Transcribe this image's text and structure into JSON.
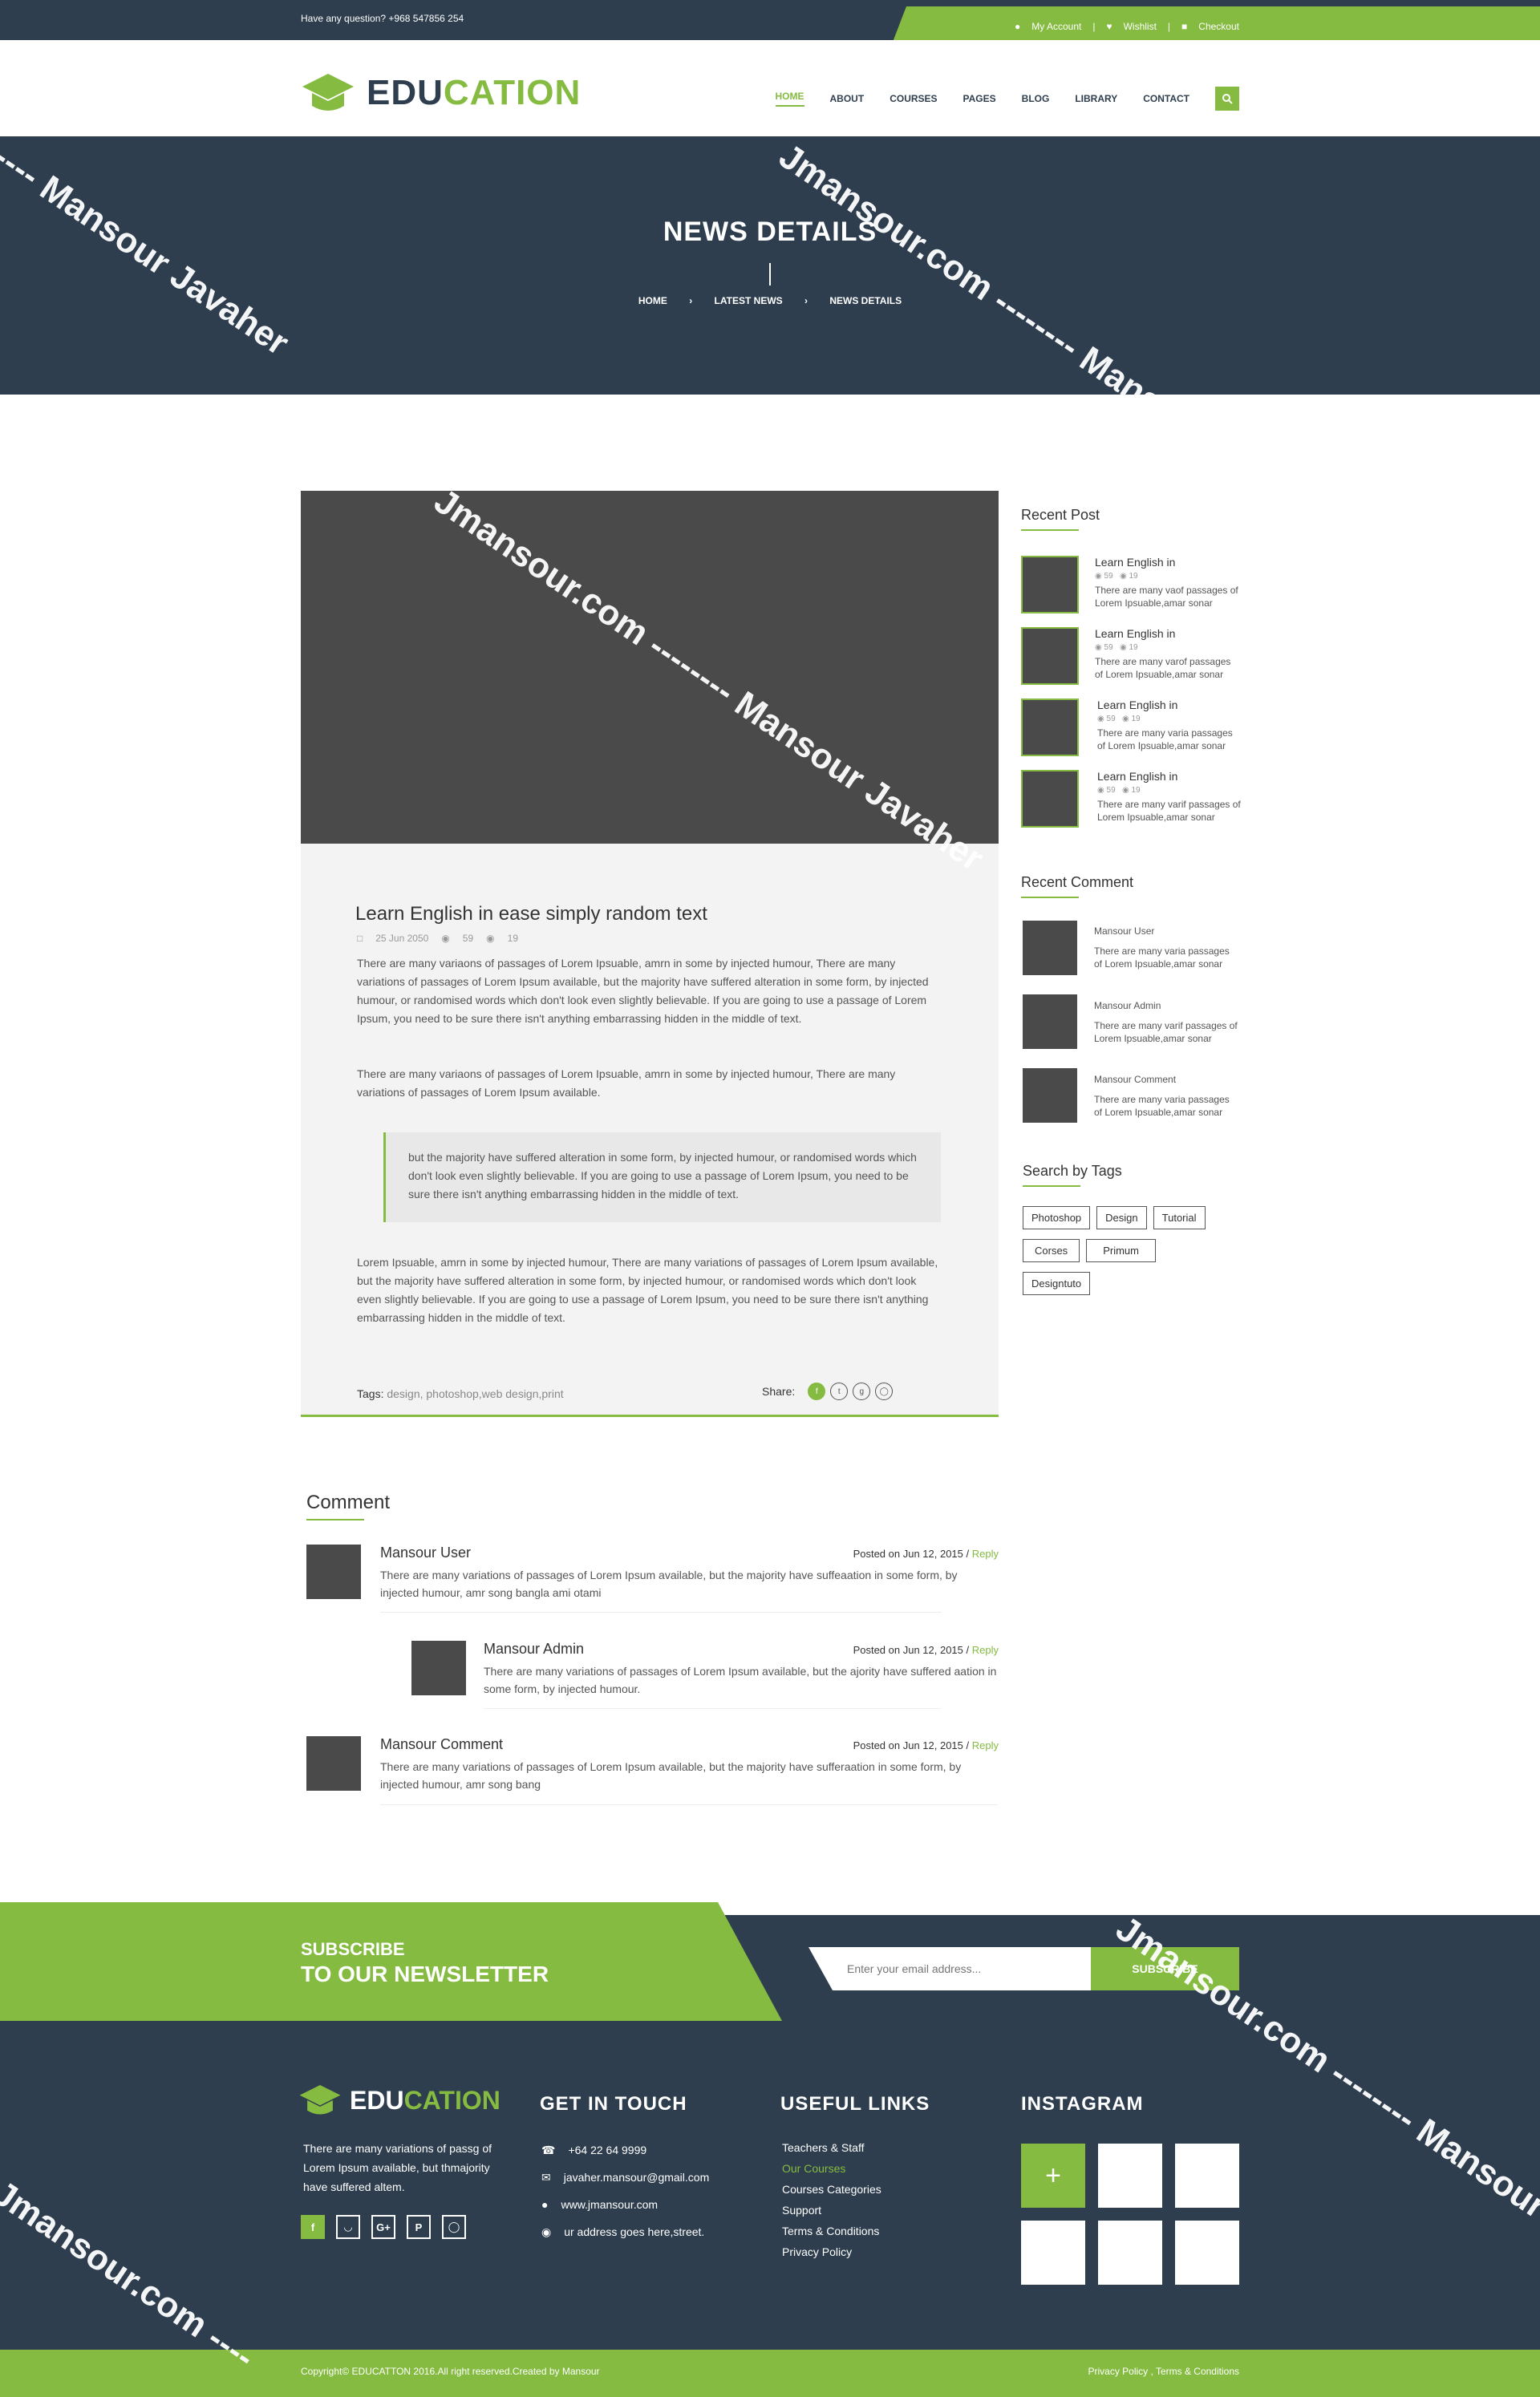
{
  "topbar": {
    "question": "Have any question? +968 547856 254",
    "links": [
      "My Account",
      "Wishlist",
      "Checkout"
    ]
  },
  "header": {
    "logo_part1": "EDU",
    "logo_part2": "CATION",
    "nav": [
      "HOME",
      "ABOUT",
      "COURSES",
      "PAGES",
      "BLOG",
      "LIBRARY",
      "CONTACT"
    ],
    "active_nav": "HOME"
  },
  "banner": {
    "title": "NEWS DETAILS",
    "breadcrumb": [
      "HOME",
      "LATEST NEWS",
      "NEWS DETAILS"
    ]
  },
  "post": {
    "title": "Learn English in ease simply random text",
    "date": "25 Jun 2050",
    "views": "59",
    "comments": "19",
    "para1": "There are many variaons of passages of Lorem Ipsuable, amrn in some by injected humour, There are many variations of passages of Lorem Ipsum available, but the majority have suffered alteration in some form, by injected humour, or randomised words which don't look even slightly believable. If you are going to use a passage of Lorem Ipsum, you need to be sure there isn't anything embarrassing hidden in the middle of text.",
    "para2": "There are many variaons of passages of Lorem Ipsuable, amrn in some by injected humour, There are many variations of passages of Lorem Ipsum available.",
    "quote": "but the majority have suffered alteration in some form, by injected humour, or randomised words which don't look even slightly believable. If you are going to use a passage of Lorem Ipsum, you need to be sure there isn't anything embarrassing hidden in the middle of text.",
    "para3": "Lorem Ipsuable, amrn in some by injected humour, There are many variations of passages of Lorem Ipsum available, but the majority have suffered alteration in some form, by injected humour, or randomised words which don't look even slightly believable. If you are going to use a passage of Lorem Ipsum, you need to be sure there isn't anything embarrassing hidden in the middle of text.",
    "tags_label": "Tags:",
    "tags_value": " design, photoshop,web design,print",
    "share_label": "Share:"
  },
  "sidebar": {
    "recent_post_title": "Recent Post",
    "recent_posts": [
      {
        "title": "Learn English in",
        "views": "59",
        "comments": "19",
        "text": "There are many vaof passages of Lorem Ipsuable,amar sonar"
      },
      {
        "title": "Learn English in",
        "views": "59",
        "comments": "19",
        "text": "There are many varof passages of Lorem Ipsuable,amar sonar"
      },
      {
        "title": "Learn English in",
        "views": "59",
        "comments": "19",
        "text": "There are many varia passages of Lorem Ipsuable,amar sonar"
      },
      {
        "title": "Learn English in",
        "views": "59",
        "comments": "19",
        "text": "There are many varif passages of Lorem Ipsuable,amar sonar"
      }
    ],
    "recent_comment_title": "Recent Comment",
    "recent_comments": [
      {
        "name": "Mansour User",
        "text": "There are many varia passages of Lorem Ipsuable,amar sonar"
      },
      {
        "name": "Mansour Admin",
        "text": "There are many varif passages of Lorem Ipsuable,amar sonar"
      },
      {
        "name": "Mansour Comment",
        "text": "There are many varia passages of Lorem Ipsuable,amar sonar"
      }
    ],
    "tags_title": "Search by Tags",
    "tags": [
      "Photoshop",
      "Design",
      "Tutorial",
      "Corses",
      "Primum",
      "Designtuto"
    ]
  },
  "comments": {
    "title": "Comment",
    "items": [
      {
        "name": "Mansour User",
        "posted": "Posted on Jun 12, 2015 /",
        "reply": "Reply",
        "text": "There are many variations of passages of Lorem Ipsum available, but the majority have suffeaation in some form, by injected humour, amr song bangla ami otami"
      },
      {
        "name": "Mansour Admin",
        "posted": "Posted on Jun 12, 2015 /",
        "reply": "Reply",
        "text": "There are many variations of passages of Lorem Ipsum available, but the ajority have suffered aation in some form, by injected humour."
      },
      {
        "name": "Mansour Comment",
        "posted": "Posted on Jun 12, 2015 /",
        "reply": "Reply",
        "text": "There are many variations of passages of Lorem Ipsum available, but the majority have sufferaation in some form, by injected humour, amr song bang"
      }
    ]
  },
  "newsletter": {
    "line1": "SUBSCRIBE",
    "line2": "TO OUR NEWSLETTER",
    "placeholder": "Enter your email address...",
    "button": "SUBSCRIBE"
  },
  "footer": {
    "about_text": "There are many variations of passg of Lorem Ipsum available, but thmajority have suffered altem.",
    "get_in_touch": "GET IN TOUCH",
    "contacts": [
      "+64 22 64 9999",
      "javaher.mansour@gmail.com",
      "www.jmansour.com",
      "ur address goes here,street."
    ],
    "useful_links_title": "USEFUL LINKS",
    "links": [
      "Teachers & Staff",
      "Our Courses",
      "Courses Categories",
      "Support",
      "Terms & Conditions",
      "Privacy Policy"
    ],
    "instagram_title": "INSTAGRAM",
    "social": [
      "f",
      "rss",
      "G+",
      "P",
      "ig"
    ]
  },
  "bottom": {
    "copyright": "Copyright© EDUCATTON 2016.All right reserved.Created by Mansour",
    "links": "Privacy Policy , Terms & Conditions"
  },
  "watermarks": [
    "---- Mansour Javaher",
    "Jmansour.com -------- Mansour Javaher",
    "Jmansour.com ----"
  ],
  "colors": {
    "accent": "#84bb40",
    "dark": "#2e3e4e",
    "placeholder": "#4a4a4a"
  }
}
